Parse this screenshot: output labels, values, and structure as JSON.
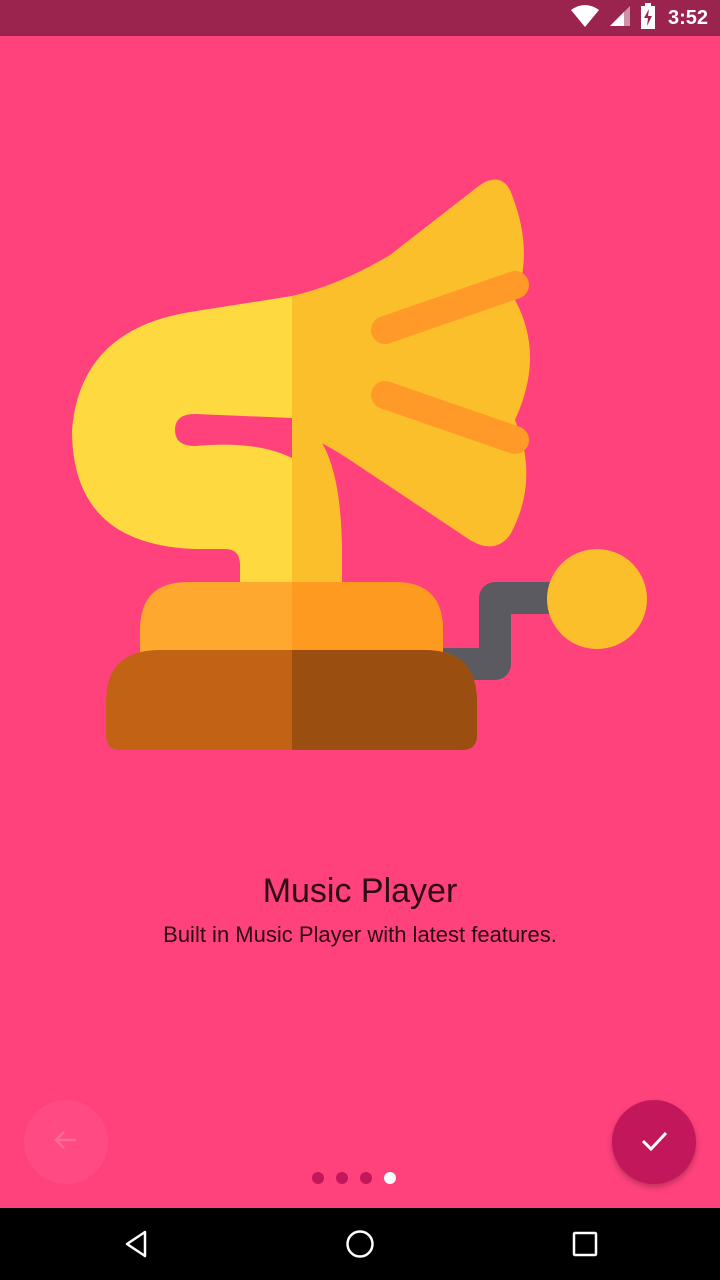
{
  "status_bar": {
    "time": "3:52",
    "icons": [
      "wifi-icon",
      "signal-icon",
      "battery-charging-icon"
    ]
  },
  "slide": {
    "illustration": "gramophone-icon",
    "title": "Music Player",
    "subtitle": "Built in Music Player with latest features."
  },
  "controls": {
    "back_icon": "arrow-left-icon",
    "done_icon": "check-icon",
    "page_count": 4,
    "current_page": 4
  },
  "nav_bar": {
    "icons": [
      "back-triangle-icon",
      "home-circle-icon",
      "recents-square-icon"
    ]
  },
  "colors": {
    "background": "#ff417c",
    "status_bar": "#9b244f",
    "accent": "#c2185b"
  }
}
